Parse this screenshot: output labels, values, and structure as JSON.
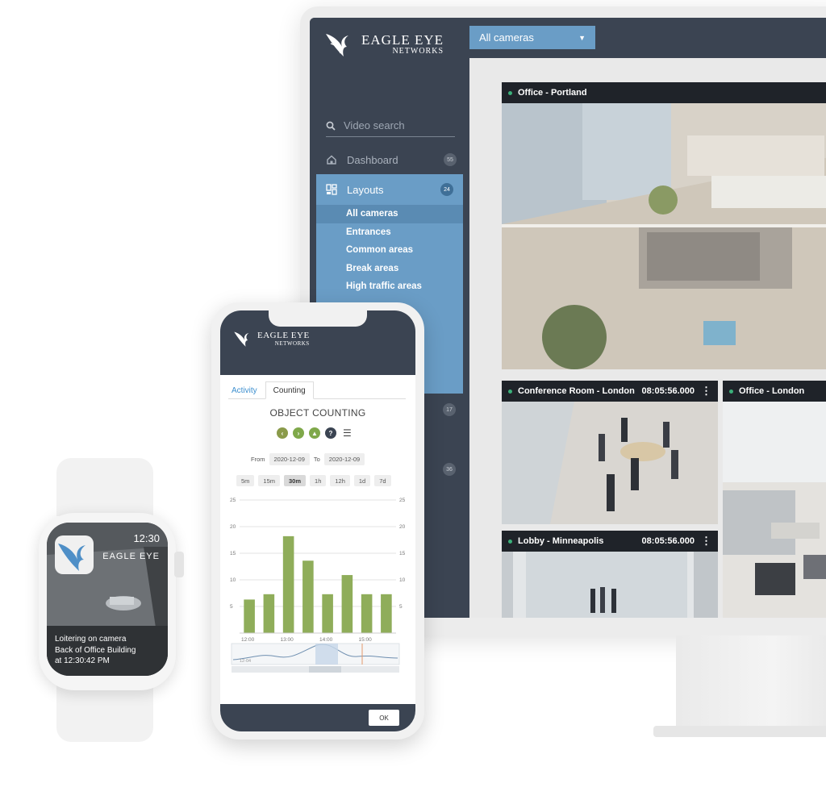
{
  "brand": {
    "name_line1": "EAGLE EYE",
    "name_line2": "NETWORKS"
  },
  "desktop": {
    "search_placeholder": "Video search",
    "nav": {
      "dashboard": {
        "label": "Dashboard",
        "count": "55"
      },
      "layouts": {
        "label": "Layouts",
        "count": "24"
      },
      "other_counts": [
        "17",
        "36"
      ]
    },
    "layout_items": [
      "All cameras",
      "Entrances",
      "Common areas",
      "Break areas",
      "High traffic areas"
    ],
    "layout_selected": "All cameras",
    "camera_dropdown": "All cameras",
    "cameras": [
      {
        "name": "Office - Portland",
        "time": ""
      },
      {
        "name": "Conference Room - London",
        "time": "08:05:56.000"
      },
      {
        "name": "Office - London",
        "time": ""
      },
      {
        "name": "Lobby - Minneapolis",
        "time": "08:05:56.000"
      }
    ],
    "colors": {
      "sidebar": "#3b4452",
      "accent": "#6a9dc6",
      "live_dot": "#3bb07a"
    }
  },
  "phone": {
    "tabs": [
      "Activity",
      "Counting"
    ],
    "active_tab": "Counting",
    "title": "OBJECT COUNTING",
    "from_label": "From",
    "from_date": "2020-12-09",
    "to_label": "To",
    "to_date": "2020-12-09",
    "ranges": [
      "5m",
      "15m",
      "30m",
      "1h",
      "12h",
      "1d",
      "7d"
    ],
    "selected_range": "30m",
    "ok_label": "OK",
    "timeline_label": "12-04"
  },
  "chart_data": {
    "type": "bar",
    "categories": [
      "12:00",
      "",
      "13:00",
      "",
      "14:00",
      "",
      "15:00",
      ""
    ],
    "x_tick_labels": [
      "12:00",
      "13:00",
      "14:00",
      "15:00"
    ],
    "values": [
      6.3,
      7.3,
      18.2,
      13.6,
      7.3,
      10.9,
      7.3,
      7.3
    ],
    "ylim": [
      0,
      25
    ],
    "y_ticks": [
      "25",
      "20",
      "15",
      "10",
      "5"
    ],
    "grid": true,
    "bar_color": "#8fad5a"
  },
  "watch": {
    "time": "12:30",
    "app": "EAGLE EYE",
    "message_line1": "Loitering on camera",
    "message_line2": "Back of Office Building",
    "message_line3": "at 12:30:42 PM"
  }
}
